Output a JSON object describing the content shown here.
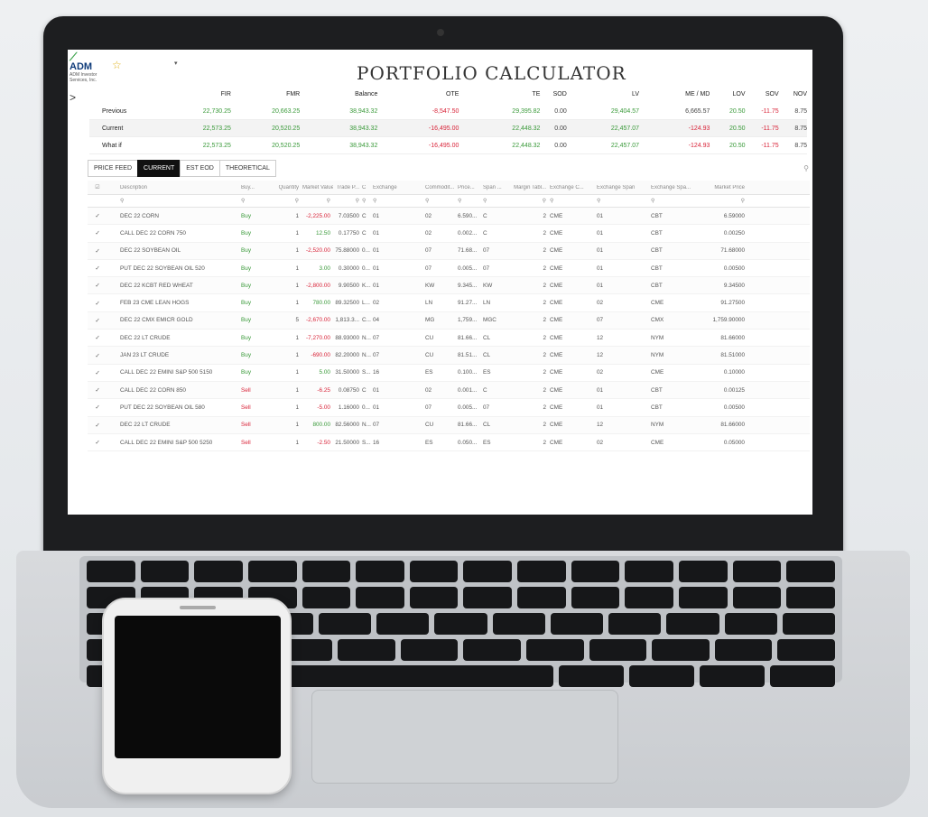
{
  "app": {
    "logo_text": "ADM",
    "logo_sub": "ADM Investor Services, Inc.",
    "title": "PORTFOLIO CALCULATOR",
    "favorite_icon": "star-icon",
    "side_toggle": ">"
  },
  "summary": {
    "headers": [
      "FIR",
      "FMR",
      "Balance",
      "OTE",
      "TE",
      "SOD",
      "LV",
      "ME / MD",
      "LOV",
      "SOV",
      "NOV"
    ],
    "rows": [
      {
        "label": "Previous",
        "values": [
          "22,730.25",
          "20,663.25",
          "38,943.32",
          "-8,547.50",
          "29,395.82",
          "0.00",
          "29,404.57",
          "6,665.57",
          "20.50",
          "-11.75",
          "8.75"
        ]
      },
      {
        "label": "Current",
        "values": [
          "22,573.25",
          "20,520.25",
          "38,943.32",
          "-16,495.00",
          "22,448.32",
          "0.00",
          "22,457.07",
          "-124.93",
          "20.50",
          "-11.75",
          "8.75"
        ]
      },
      {
        "label": "What if",
        "values": [
          "22,573.25",
          "20,520.25",
          "38,943.32",
          "-16,495.00",
          "22,448.32",
          "0.00",
          "22,457.07",
          "-124.93",
          "20.50",
          "-11.75",
          "8.75"
        ]
      }
    ]
  },
  "tabs": [
    "PRICE FEED",
    "CURRENT",
    "EST EOD",
    "THEORETICAL"
  ],
  "grid": {
    "headers": [
      "Description",
      "Buy...",
      "Quantity",
      "Market Value",
      "Trade P...",
      "C",
      "Exchange",
      "Commodit...",
      "Price...",
      "Span ...",
      "Margin Tabl...",
      "Exchange C...",
      "Exchange Span",
      "Exchange Spa...",
      "Market Price"
    ],
    "rows": [
      {
        "desc": "DEC 22 CORN",
        "side": "Buy",
        "qty": "1",
        "mv": "-2,225.00",
        "tp": "7.03500",
        "c": "C",
        "ex": "01",
        "com": "02",
        "pr": "6.590...",
        "sp": "C",
        "mt": "2",
        "ec": "CME",
        "es": "01",
        "esa": "CBT",
        "mp": "6.59000"
      },
      {
        "desc": "CALL DEC 22 CORN 750",
        "side": "Buy",
        "qty": "1",
        "mv": "12.50",
        "tp": "0.17750",
        "c": "C",
        "ex": "01",
        "com": "02",
        "pr": "0.002...",
        "sp": "C",
        "mt": "2",
        "ec": "CME",
        "es": "01",
        "esa": "CBT",
        "mp": "0.00250"
      },
      {
        "desc": "DEC 22 SOYBEAN OIL",
        "side": "Buy",
        "qty": "1",
        "mv": "-2,520.00",
        "tp": "75.88000",
        "c": "0...",
        "ex": "01",
        "com": "07",
        "pr": "71.68...",
        "sp": "07",
        "mt": "2",
        "ec": "CME",
        "es": "01",
        "esa": "CBT",
        "mp": "71.68000"
      },
      {
        "desc": "PUT DEC 22 SOYBEAN OIL 520",
        "side": "Buy",
        "qty": "1",
        "mv": "3.00",
        "tp": "0.30000",
        "c": "0...",
        "ex": "01",
        "com": "07",
        "pr": "0.005...",
        "sp": "07",
        "mt": "2",
        "ec": "CME",
        "es": "01",
        "esa": "CBT",
        "mp": "0.00500"
      },
      {
        "desc": "DEC 22 KCBT RED WHEAT",
        "side": "Buy",
        "qty": "1",
        "mv": "-2,800.00",
        "tp": "9.90500",
        "c": "K...",
        "ex": "01",
        "com": "KW",
        "pr": "9.345...",
        "sp": "KW",
        "mt": "2",
        "ec": "CME",
        "es": "01",
        "esa": "CBT",
        "mp": "9.34500"
      },
      {
        "desc": "FEB 23 CME LEAN HOGS",
        "side": "Buy",
        "qty": "1",
        "mv": "780.00",
        "tp": "89.32500",
        "c": "L...",
        "ex": "02",
        "com": "LN",
        "pr": "91.27...",
        "sp": "LN",
        "mt": "2",
        "ec": "CME",
        "es": "02",
        "esa": "CME",
        "mp": "91.27500"
      },
      {
        "desc": "DEC 22 CMX EMICR GOLD",
        "side": "Buy",
        "qty": "5",
        "mv": "-2,670.00",
        "tp": "1,813.3...",
        "c": "C...",
        "ex": "04",
        "com": "MG",
        "pr": "1,759...",
        "sp": "MGC",
        "mt": "2",
        "ec": "CME",
        "es": "07",
        "esa": "CMX",
        "mp": "1,759.90000"
      },
      {
        "desc": "DEC 22 LT CRUDE",
        "side": "Buy",
        "qty": "1",
        "mv": "-7,270.00",
        "tp": "88.93000",
        "c": "N...",
        "ex": "07",
        "com": "CU",
        "pr": "81.66...",
        "sp": "CL",
        "mt": "2",
        "ec": "CME",
        "es": "12",
        "esa": "NYM",
        "mp": "81.66000"
      },
      {
        "desc": "JAN 23 LT CRUDE",
        "side": "Buy",
        "qty": "1",
        "mv": "-690.00",
        "tp": "82.20000",
        "c": "N...",
        "ex": "07",
        "com": "CU",
        "pr": "81.51...",
        "sp": "CL",
        "mt": "2",
        "ec": "CME",
        "es": "12",
        "esa": "NYM",
        "mp": "81.51000"
      },
      {
        "desc": "CALL DEC 22 EMINI S&P 500 5150",
        "side": "Buy",
        "qty": "1",
        "mv": "5.00",
        "tp": "31.50000",
        "c": "S...",
        "ex": "16",
        "com": "ES",
        "pr": "0.100...",
        "sp": "ES",
        "mt": "2",
        "ec": "CME",
        "es": "02",
        "esa": "CME",
        "mp": "0.10000"
      },
      {
        "desc": "CALL DEC 22 CORN 850",
        "side": "Sell",
        "qty": "1",
        "mv": "-6.25",
        "tp": "0.08750",
        "c": "C",
        "ex": "01",
        "com": "02",
        "pr": "0.001...",
        "sp": "C",
        "mt": "2",
        "ec": "CME",
        "es": "01",
        "esa": "CBT",
        "mp": "0.00125"
      },
      {
        "desc": "PUT DEC 22 SOYBEAN OIL 580",
        "side": "Sell",
        "qty": "1",
        "mv": "-5.00",
        "tp": "1.16000",
        "c": "0...",
        "ex": "01",
        "com": "07",
        "pr": "0.005...",
        "sp": "07",
        "mt": "2",
        "ec": "CME",
        "es": "01",
        "esa": "CBT",
        "mp": "0.00500"
      },
      {
        "desc": "DEC 22 LT CRUDE",
        "side": "Sell",
        "qty": "1",
        "mv": "800.00",
        "tp": "82.56000",
        "c": "N...",
        "ex": "07",
        "com": "CU",
        "pr": "81.66...",
        "sp": "CL",
        "mt": "2",
        "ec": "CME",
        "es": "12",
        "esa": "NYM",
        "mp": "81.66000"
      },
      {
        "desc": "CALL DEC 22 EMINI S&P 500 5250",
        "side": "Sell",
        "qty": "1",
        "mv": "-2.50",
        "tp": "21.50000",
        "c": "S...",
        "ex": "16",
        "com": "ES",
        "pr": "0.050...",
        "sp": "ES",
        "mt": "2",
        "ec": "CME",
        "es": "02",
        "esa": "CME",
        "mp": "0.05000"
      }
    ]
  },
  "colors": {
    "positive": "#3a9a3a",
    "negative": "#d9253a",
    "active_tab": "#111111",
    "brand_green": "#3aa24a",
    "brand_blue": "#0e3b7a"
  }
}
